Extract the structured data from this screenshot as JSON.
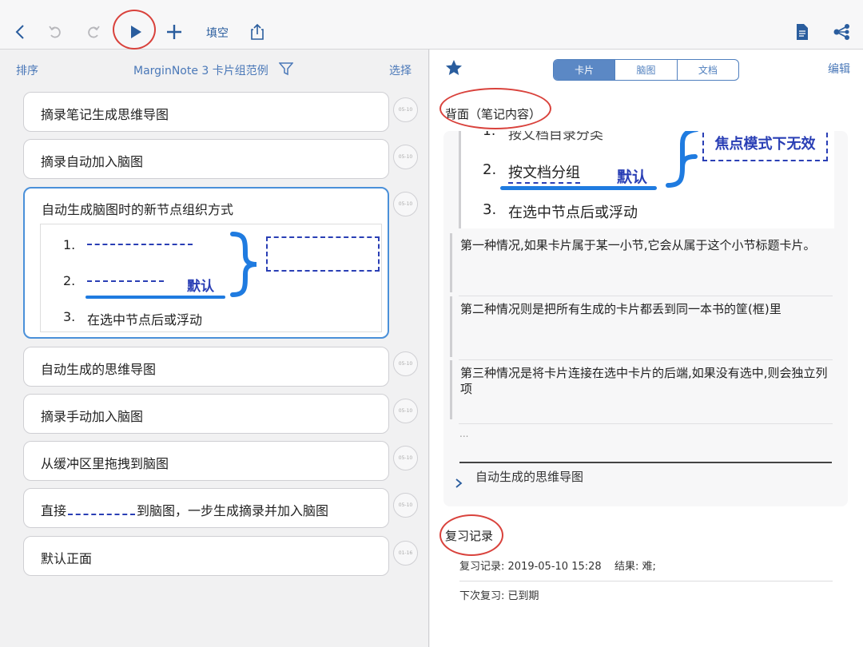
{
  "toolbar": {
    "fill_label": "填空",
    "icons": [
      "back-icon",
      "undo-icon",
      "redo-icon",
      "play-icon",
      "plus-icon",
      "share-icon",
      "document-icon",
      "mindmap-share-icon"
    ]
  },
  "left": {
    "sort_label": "排序",
    "title": "MarginNote 3 卡片组范例",
    "select_label": "选择",
    "cards": [
      {
        "title": "摘录笔记生成思维导图",
        "date": "05-10"
      },
      {
        "title": "摘录自动加入脑图",
        "date": "05-10"
      },
      {
        "title": "自动生成脑图时的新节点组织方式",
        "date": "05-10"
      },
      {
        "title": "自动生成的思维导图",
        "date": "05-10"
      },
      {
        "title": "摘录手动加入脑图",
        "date": "05-10"
      },
      {
        "title": "从缓冲区里拖拽到脑图",
        "date": "05-10"
      },
      {
        "title_prefix": "直接",
        "title_suffix": "到脑图，一步生成摘录并加入脑图",
        "date": "05-10"
      },
      {
        "title": "默认正面",
        "date": "01-16"
      }
    ],
    "selected_preview": {
      "n1": "1.",
      "n2": "2.",
      "n3": "3.",
      "item3": "在选中节点后或浮动",
      "default_label": "默认"
    }
  },
  "right": {
    "edit_label": "编辑",
    "tabs": [
      "卡片",
      "脑图",
      "文档"
    ],
    "active_tab": 0,
    "back_heading": "背面（笔记内容）",
    "image": {
      "item1_partial": "按文档目录分类",
      "item2": "按文档分组",
      "item3": "在选中节点后或浮动",
      "default_label": "默认",
      "focus_label": "焦点模式下无效",
      "n1": "1.",
      "n2": "2.",
      "n3": "3."
    },
    "paragraphs": [
      "第一种情况,如果卡片属于某一小节,它会从属于这个小节标题卡片。",
      "第二种情况则是把所有生成的卡片都丢到同一本书的筐(框)里",
      "第三种情况是将卡片连接在选中卡片的后端,如果没有选中,则会独立列项"
    ],
    "ellipsis": "...",
    "linked_card": "自动生成的思维导图",
    "review_heading": "复习记录",
    "review_record": "复习记录: 2019-05-10 15:28",
    "review_result": "结果: 难;",
    "next_review": "下次复习: 已到期"
  },
  "colors": {
    "accent": "#2a5d9e",
    "highlight_blue": "#1f7be0",
    "annotation_red": "#d9423c",
    "dashed_blue": "#2a3fb5"
  }
}
